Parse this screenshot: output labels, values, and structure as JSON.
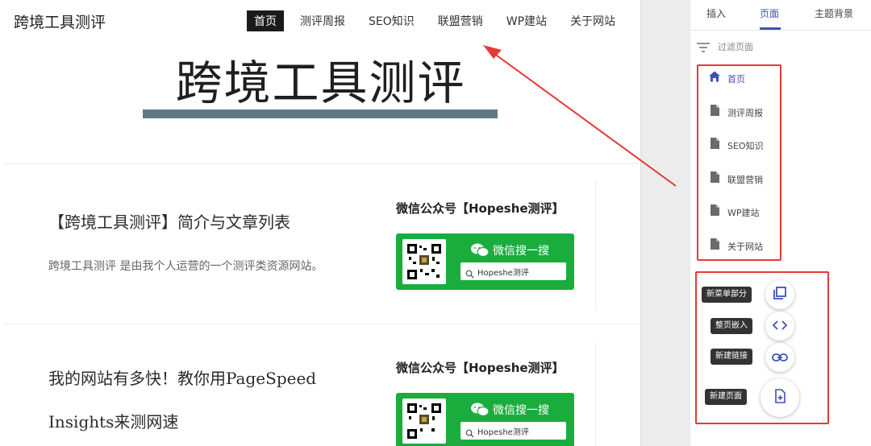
{
  "site": {
    "title": "跨境工具测评",
    "nav": [
      "首页",
      "测评周报",
      "SEO知识",
      "联盟营销",
      "WP建站",
      "关于网站"
    ],
    "hero_title": "跨境工具测评"
  },
  "posts": [
    {
      "title": "【跨境工具测评】简介与文章列表",
      "desc": "跨境工具测评 是由我个人运营的一个测评类资源网站。"
    },
    {
      "title": "我的网站有多快！教你用PageSpeed Insights来测网速",
      "desc": ""
    }
  ],
  "widget": {
    "title": "微信公众号【Hopeshe测评】",
    "wechat_label": "微信搜一搜",
    "search_text": "Hopeshe测评"
  },
  "panel": {
    "tabs": [
      "插入",
      "页面",
      "主题背景"
    ],
    "active_tab": 1,
    "filter_label": "过滤页面",
    "pages": [
      "首页",
      "测评周报",
      "SEO知识",
      "联盟营销",
      "WP建站",
      "关于网站"
    ],
    "actions": [
      {
        "tooltip": "新菜单部分",
        "icon": "copy-icon"
      },
      {
        "tooltip": "整页嵌入",
        "icon": "code-icon"
      },
      {
        "tooltip": "新建链接",
        "icon": "link-icon"
      },
      {
        "tooltip": "新建页面",
        "icon": "new-page-icon"
      }
    ]
  },
  "colors": {
    "accent": "#3f51b5",
    "wechat_green": "#1aad3e",
    "annotation_red": "#e53935",
    "hero_bar": "#5f7a86"
  }
}
